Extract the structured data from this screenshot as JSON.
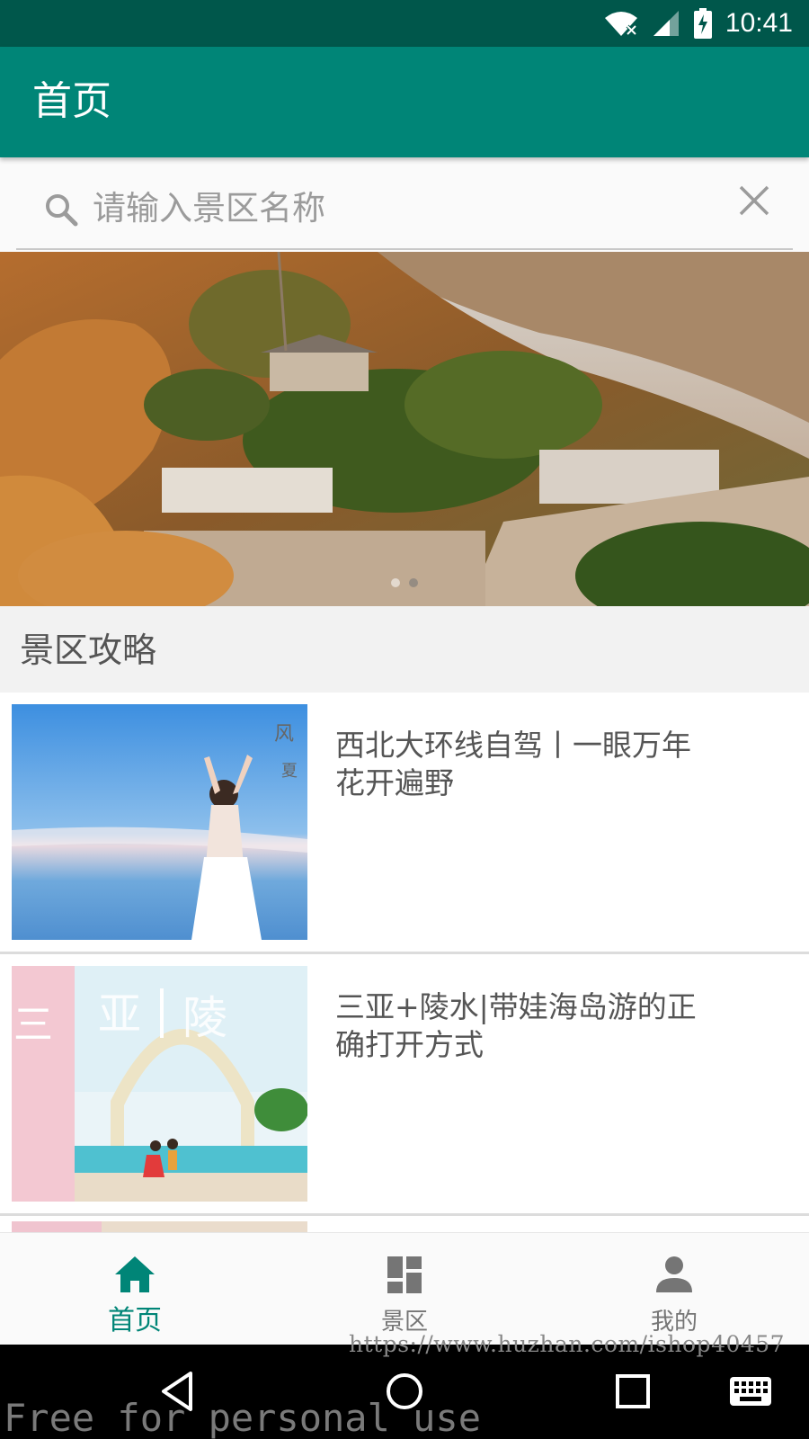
{
  "status_bar": {
    "time": "10:41",
    "icons": [
      "wifi-icon",
      "signal-icon",
      "battery-charging-icon"
    ]
  },
  "app_bar": {
    "title": "首页"
  },
  "search": {
    "placeholder": "请输入景区名称",
    "value": "",
    "left_icon": "search-icon",
    "right_icon": "close-icon"
  },
  "banner": {
    "dots": 2,
    "active_dot": 0
  },
  "section": {
    "title": "景区攻略"
  },
  "list": {
    "items": [
      {
        "title": "西北大环线自驾丨一眼万年 花开遍野"
      },
      {
        "title": "三亚+陵水|带娃海岛游的正确打开方式"
      },
      {
        "title": ""
      }
    ]
  },
  "bottom_nav": {
    "items": [
      {
        "label": "首页",
        "icon": "home-icon",
        "active": true
      },
      {
        "label": "景区",
        "icon": "dashboard-icon",
        "active": false
      },
      {
        "label": "我的",
        "icon": "person-icon",
        "active": false
      }
    ]
  },
  "system_nav": {
    "icons": [
      "back-icon",
      "home-circle-icon",
      "recents-icon",
      "keyboard-icon"
    ]
  },
  "watermarks": {
    "url": "https://www.huzhan.com/ishop40457",
    "free": "Free for personal use"
  },
  "colors": {
    "primary": "#008577",
    "primary_dark": "#00574b",
    "accent": "#008577"
  }
}
